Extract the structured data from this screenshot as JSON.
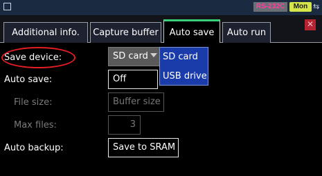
{
  "status_bar": {
    "window_icon": "window-square-icon",
    "interface": "RS-232C",
    "mode": "Mon",
    "usb_icon": "usb-icon"
  },
  "tabs": [
    {
      "label": "Additional info.",
      "active": false
    },
    {
      "label": "Capture buffer",
      "active": false
    },
    {
      "label": "Auto save",
      "active": true
    },
    {
      "label": "Auto run",
      "active": false
    }
  ],
  "close_icon": "close-x-icon",
  "form": {
    "save_device": {
      "label": "Save device:",
      "value": "SD card",
      "options": [
        "SD card",
        "USB drive"
      ]
    },
    "auto_save": {
      "label": "Auto save:",
      "value": "Off"
    },
    "file_size": {
      "label": "File size:",
      "value": "Buffer size"
    },
    "max_files": {
      "label": "Max files:",
      "value": "3"
    },
    "auto_backup": {
      "label": "Auto backup:",
      "value": "Save to SRAM"
    }
  },
  "colors": {
    "highlight": "#e61d22",
    "dropdown_bg": "#1a3caa",
    "active_tab_accent": "#39d07a",
    "mode_badge": "#d6e64a"
  }
}
